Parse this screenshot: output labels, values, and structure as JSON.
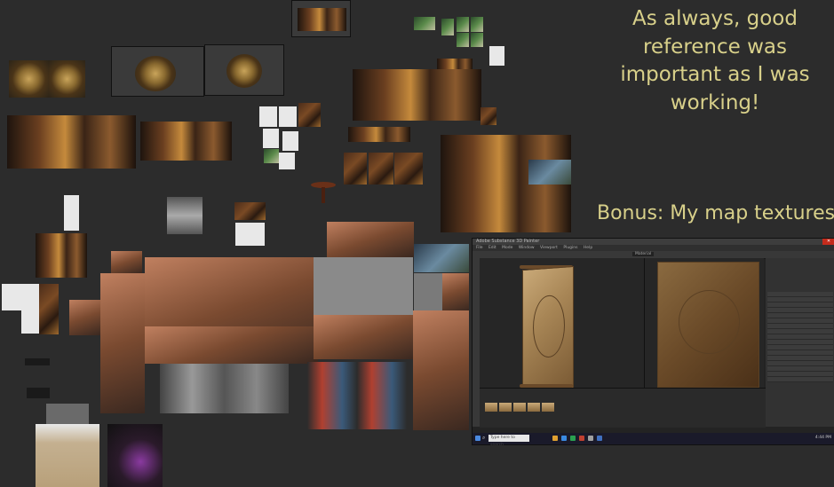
{
  "captions": {
    "reference_note": "As always, good reference was important as I was working!",
    "bonus_note": "Bonus: My map textures"
  },
  "photoshop": {
    "window_title": "Adobe Substance 3D Painter",
    "menu_items": [
      "File",
      "Edit",
      "Mode",
      "Window",
      "Viewport",
      "Plugins",
      "Help"
    ],
    "view_mode": "Material",
    "taskbar_search": "Type here to search",
    "taskbar_time": "4:44 PM"
  },
  "colors": {
    "caption": "#d8d08a",
    "background": "#2c2c2c",
    "accent_red": "#c42b1c"
  },
  "icons": [
    "windows-start-icon",
    "search-icon"
  ]
}
